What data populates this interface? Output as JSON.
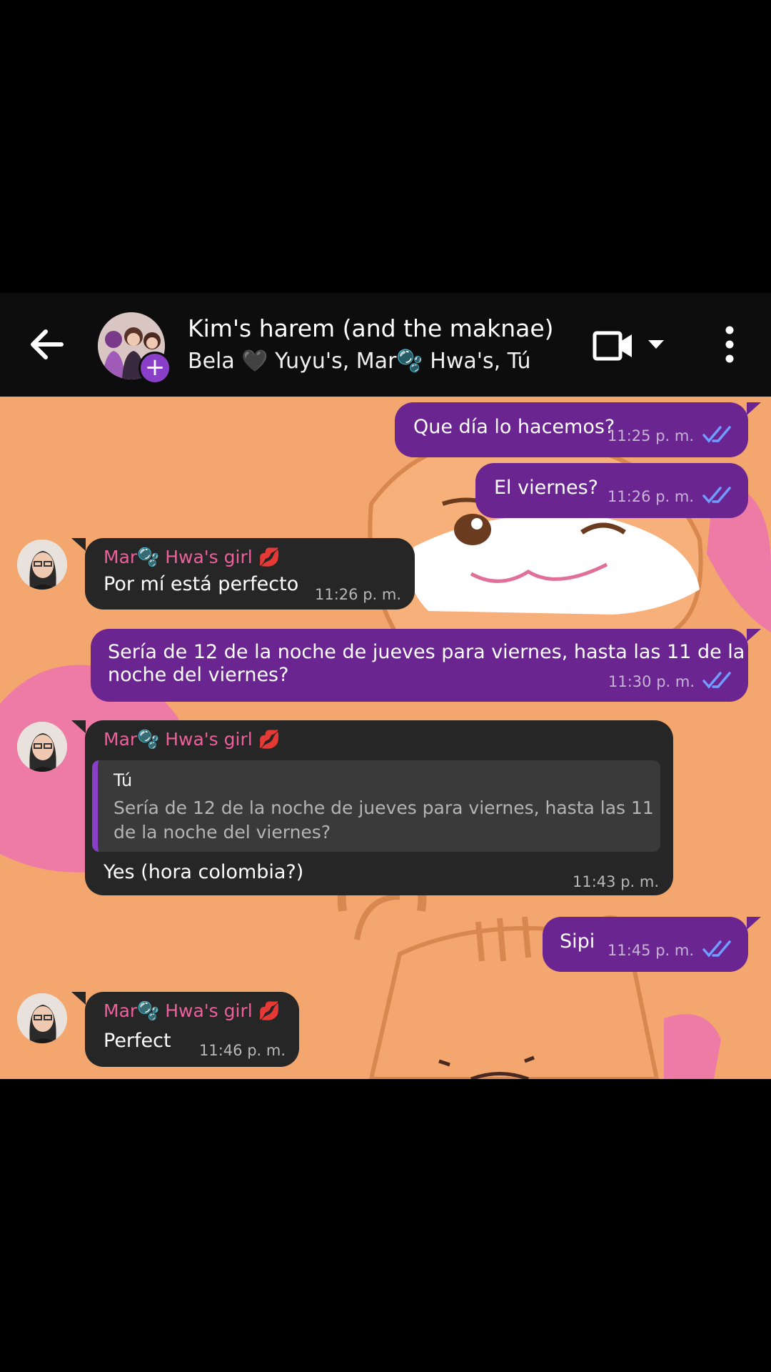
{
  "header": {
    "title": "Kim's harem (and the maknae)",
    "subtitle": "Bela 🖤 Yuyu's, Mar🫧 Hwa's, Tú",
    "back_icon": "arrow-left-icon",
    "add_icon": "plus-icon",
    "video_icon": "video-camera-icon",
    "dropdown_icon": "caret-down-icon",
    "more_icon": "more-vertical-icon"
  },
  "colors": {
    "outgoing_bubble": "#6b2590",
    "incoming_bubble": "#262626",
    "sender_name": "#ee5f9c",
    "read_ticks": "#6f9dff",
    "wallpaper": "#f4a66f"
  },
  "messages": [
    {
      "direction": "out",
      "text": "Que día lo hacemos?",
      "time": "11:25 p. m.",
      "status": "read"
    },
    {
      "direction": "out",
      "text": "El viernes?",
      "time": "11:26 p. m.",
      "status": "read"
    },
    {
      "direction": "in",
      "sender": "Mar🫧 Hwa's girl 💋",
      "text": "Por mí está perfecto",
      "time": "11:26 p. m."
    },
    {
      "direction": "out",
      "text_line1": "Sería de 12 de la noche de jueves para viernes, hasta las 11 de la",
      "text_line2": "noche del viernes?",
      "time": "11:30 p. m.",
      "status": "read"
    },
    {
      "direction": "in",
      "sender": "Mar🫧 Hwa's girl 💋",
      "quote_author": "Tú",
      "quote_text": "Sería de 12 de la noche de jueves para viernes, hasta las 11 de la noche del viernes?",
      "text": "Yes (hora colombia?)",
      "time": "11:43 p. m."
    },
    {
      "direction": "out",
      "text": "Sipi",
      "time": "11:45 p. m.",
      "status": "read"
    },
    {
      "direction": "in",
      "sender": "Mar🫧 Hwa's girl 💋",
      "text": "Perfect",
      "time": "11:46 p. m."
    }
  ]
}
